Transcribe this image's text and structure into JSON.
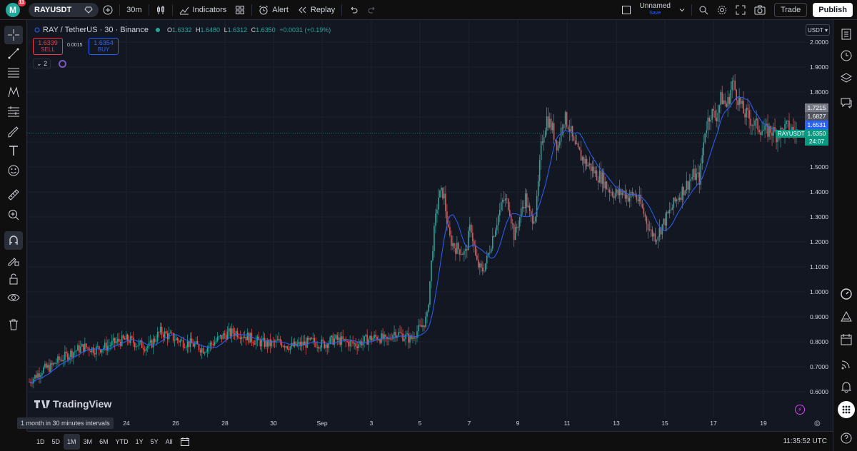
{
  "topbar": {
    "avatar_letter": "M",
    "notification_count": "11",
    "symbol": "RAYUSDT",
    "interval": "30m",
    "indicators": "Indicators",
    "alert": "Alert",
    "replay": "Replay",
    "layout_name": "Unnamed",
    "layout_save": "Save",
    "trade": "Trade",
    "publish": "Publish"
  },
  "legend": {
    "title": "RAY / TetherUS · 30 · Binance",
    "open_key": "O",
    "open": "1.6332",
    "high_key": "H",
    "high": "1.6480",
    "low_key": "L",
    "low": "1.6312",
    "close_key": "C",
    "close": "1.6350",
    "change": "+0.0031 (+0.19%)"
  },
  "trade_panel": {
    "sell_price": "1.6339",
    "sell_label": "SELL",
    "spread": "0.0015",
    "buy_price": "1.6354",
    "buy_label": "BUY",
    "collapse_count": "2"
  },
  "branding": {
    "logo_text": "TradingView"
  },
  "price_axis": {
    "currency": "USDT",
    "ticks": [
      "2.0000",
      "1.9000",
      "1.8000",
      "1.5000",
      "1.4000",
      "1.3000",
      "1.2000",
      "1.1000",
      "1.0000",
      "0.9000",
      "0.8000",
      "0.7000",
      "0.6000"
    ],
    "labels": {
      "high_level": "1.7215",
      "mid_level": "1.6827",
      "ma_level": "1.6531",
      "last_price": "1.6350",
      "countdown": "24:07",
      "symbol_tag": "RAYUSDT"
    }
  },
  "time_axis": {
    "interval_tooltip": "1 month in 30 minutes intervals",
    "ticks": [
      "24",
      "26",
      "28",
      "30",
      "Sep",
      "3",
      "5",
      "7",
      "9",
      "11",
      "13",
      "15",
      "17",
      "19"
    ]
  },
  "bottombar": {
    "ranges": [
      "1D",
      "5D",
      "1M",
      "3M",
      "6M",
      "YTD",
      "1Y",
      "5Y",
      "All"
    ],
    "active_range": "1M",
    "clock": "11:35:52 UTC"
  },
  "colors": {
    "up": "#26a69a",
    "down": "#ef5350",
    "ma": "#2962ff",
    "bg": "#131722",
    "panel": "#0f0f0f"
  },
  "chart_data": {
    "type": "candlestick",
    "symbol": "RAY / TetherUS",
    "interval": "30",
    "exchange": "Binance",
    "ylim": [
      0.57,
      2.06
    ],
    "x_ticks": [
      "24",
      "26",
      "28",
      "30",
      "Sep",
      "3",
      "5",
      "7",
      "9",
      "11",
      "13",
      "15",
      "17",
      "19"
    ],
    "price_path_days": [
      0,
      0.2,
      0.5,
      0.8,
      1.0,
      1.3,
      1.6,
      2.0,
      2.4,
      2.8,
      3.2,
      3.6,
      4.0,
      4.4,
      4.8,
      5.2,
      5.6,
      6.0,
      6.4,
      6.8,
      7.2,
      7.6,
      8.0,
      8.4,
      8.8,
      9.2,
      9.6,
      10.0,
      10.4,
      10.8,
      11.2,
      11.6,
      12.0,
      12.4,
      12.8,
      13.0,
      13.1,
      13.2,
      13.3,
      13.4,
      13.6,
      13.8,
      14.0,
      14.2,
      14.4,
      14.6,
      14.8,
      15.0,
      15.2,
      15.4,
      15.6,
      15.8,
      16.0,
      16.2,
      16.4,
      16.6,
      16.8,
      17.0,
      17.2,
      17.4,
      17.6,
      17.8,
      18.0,
      18.2,
      18.4,
      18.6,
      18.8,
      19.0,
      19.2,
      19.4,
      19.6,
      19.8,
      20.0,
      20.2,
      20.4,
      20.6,
      20.8,
      21.0,
      21.2,
      21.4,
      21.6,
      21.8,
      22.0,
      22.2,
      22.4,
      22.6,
      22.8,
      23.0,
      23.2,
      23.4,
      23.6,
      23.8,
      24.0,
      24.2,
      24.4,
      24.6,
      24.8,
      25.0,
      25.2,
      25.4,
      25.6,
      25.8,
      26.0,
      26.2,
      26.4,
      26.6,
      26.8,
      27.0,
      27.2,
      27.4,
      27.6,
      27.8,
      28.0,
      28.2
    ],
    "price_path": [
      0.64,
      0.66,
      0.69,
      0.7,
      0.72,
      0.74,
      0.76,
      0.78,
      0.77,
      0.78,
      0.8,
      0.81,
      0.79,
      0.78,
      0.84,
      0.82,
      0.8,
      0.79,
      0.77,
      0.8,
      0.83,
      0.84,
      0.82,
      0.8,
      0.79,
      0.8,
      0.78,
      0.79,
      0.8,
      0.79,
      0.81,
      0.8,
      0.79,
      0.81,
      0.82,
      0.81,
      0.8,
      0.81,
      0.83,
      0.84,
      0.83,
      0.82,
      0.81,
      0.84,
      0.86,
      0.9,
      1.18,
      1.38,
      1.4,
      1.22,
      1.18,
      1.17,
      1.15,
      1.27,
      1.12,
      1.08,
      1.13,
      1.22,
      1.3,
      1.37,
      1.35,
      1.22,
      1.3,
      1.38,
      1.29,
      1.32,
      1.6,
      1.7,
      1.65,
      1.58,
      1.7,
      1.67,
      1.58,
      1.55,
      1.52,
      1.5,
      1.47,
      1.46,
      1.42,
      1.4,
      1.39,
      1.4,
      1.38,
      1.39,
      1.36,
      1.3,
      1.24,
      1.22,
      1.26,
      1.3,
      1.34,
      1.38,
      1.41,
      1.44,
      1.47,
      1.45,
      1.65,
      1.72,
      1.7,
      1.78,
      1.74,
      1.84,
      1.78,
      1.72,
      1.7,
      1.67,
      1.66,
      1.64,
      1.65,
      1.63,
      1.64,
      1.66,
      1.65,
      1.63,
      1.64,
      1.64
    ]
  }
}
